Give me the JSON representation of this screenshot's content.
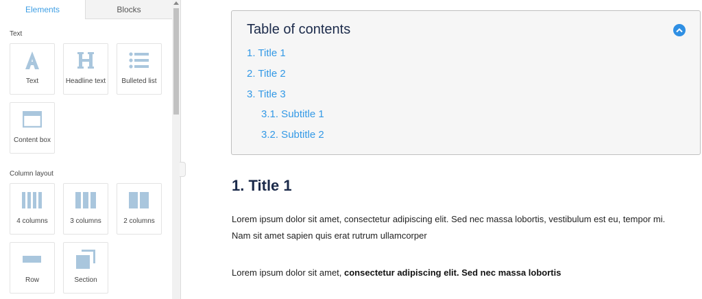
{
  "panel": {
    "tabs": [
      {
        "label": "Elements",
        "active": true
      },
      {
        "label": "Blocks",
        "active": false
      }
    ],
    "groups": {
      "text": {
        "label": "Text",
        "tiles": [
          {
            "label": "Text",
            "icon": "letter-a-icon"
          },
          {
            "label": "Headline text",
            "icon": "letter-h-icon"
          },
          {
            "label": "Bulleted list",
            "icon": "bulleted-list-icon"
          },
          {
            "label": "Content box",
            "icon": "content-box-icon"
          }
        ]
      },
      "columns": {
        "label": "Column layout",
        "tiles": [
          {
            "label": "4 columns",
            "icon": "four-columns-icon"
          },
          {
            "label": "3 columns",
            "icon": "three-columns-icon"
          },
          {
            "label": "2 columns",
            "icon": "two-columns-icon"
          },
          {
            "label": "Row",
            "icon": "row-icon"
          },
          {
            "label": "Section",
            "icon": "section-icon"
          }
        ]
      }
    },
    "icon_color": "#a9c6dd"
  },
  "toc": {
    "title": "Table of contents",
    "items": [
      {
        "label": "1. Title 1",
        "level": 1
      },
      {
        "label": "2. Title 2",
        "level": 1
      },
      {
        "label": "3. Title 3",
        "level": 1
      },
      {
        "label": "3.1. Subtitle 1",
        "level": 2
      },
      {
        "label": "3.2. Subtitle 2",
        "level": 2
      }
    ],
    "link_color": "#3399e6",
    "toggle_color": "#2f8fe3"
  },
  "content": {
    "heading": "1. Title 1",
    "para1_line1": "Lorem ipsum dolor sit amet, consectetur adipiscing elit. Sed nec massa lobortis, vestibulum est eu, tempor mi.",
    "para1_line2": "Nam sit amet sapien quis erat rutrum ullamcorper",
    "para2_normal": "Lorem ipsum dolor sit amet, ",
    "para2_bold": "consectetur adipiscing elit. Sed nec massa lobortis"
  }
}
